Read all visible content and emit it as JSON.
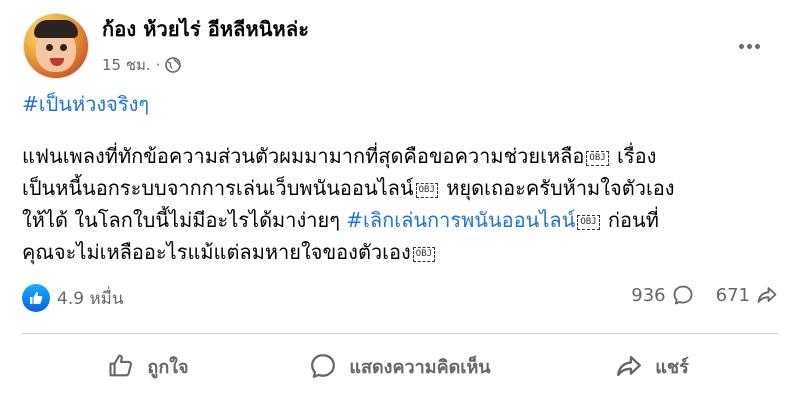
{
  "post": {
    "author": "ก้อง ห้วยไร่ อีหลีหนิหล่ะ",
    "time": "15 ชม.",
    "separator": "·",
    "hashtag": "#เป็นห่วงจริงๆ",
    "obj_placeholder": "OBJ",
    "body": {
      "l1a": "แฟนเพลงที่ทักข้อความส่วนตัวผมมามากที่สุดคือขอความช่วยเหลือ",
      "l1b": " เรื่อง",
      "l2a": "เป็นหนี้นอกระบบจากการเล่นเว็บพนันออนไลน์",
      "l2b": " หยุดเถอะครับห้ามใจตัวเอง",
      "l3a": "ให้ได้ ในโลกใบนี้ไม่มีอะไรได้มาง่ายๆ ",
      "l3tag": "#เลิกเล่นการพนันออนไลน์",
      "l3b": " ก่อนที่",
      "l4a": "คุณจะไม่เหลืออะไรแม้แต่ลมหายใจของตัวเอง"
    }
  },
  "stats": {
    "reactions": "4.9 หมื่น",
    "comments": "936",
    "shares": "671"
  },
  "actions": {
    "like": "ถูกใจ",
    "comment": "แสดงความคิดเห็น",
    "share": "แชร์"
  },
  "icons": {
    "privacy": "globe-icon",
    "more": "more-icon",
    "like": "thumbs-up-icon",
    "comment": "comment-icon",
    "share": "share-arrow-icon"
  },
  "colors": {
    "link": "#1b74e4",
    "muted": "#65676b",
    "like_badge": "#0d6efd"
  }
}
